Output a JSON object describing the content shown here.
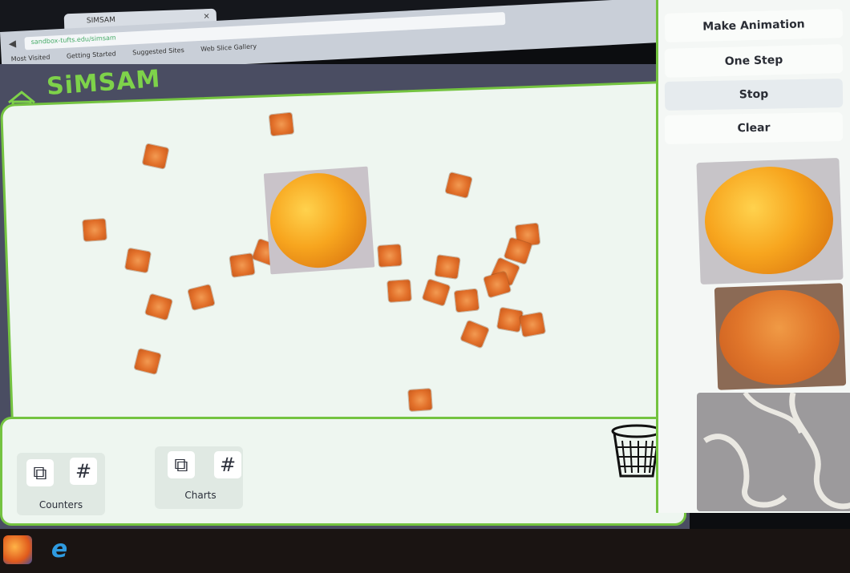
{
  "browser": {
    "tab_title": "SIMSAM",
    "url": "sandbox-tufts.edu/simsam",
    "bookmarks": [
      "Most Visited",
      "Getting Started",
      "Suggested Sites",
      "Web Slice Gallery"
    ]
  },
  "app": {
    "logo": "SiMSAM"
  },
  "sidebar": {
    "buttons": [
      "Make Animation",
      "One Step",
      "Stop",
      "Clear"
    ],
    "active": "Stop"
  },
  "tools": {
    "counters_label": "Counters",
    "charts_label": "Charts",
    "hash_glyph": "#"
  },
  "icons": {
    "home": "home-icon",
    "trash": "trash-icon",
    "duplicate": "copy-icon",
    "hash": "hash-icon"
  },
  "colors": {
    "accent": "#74c340",
    "app_bg": "#4a4d62",
    "canvas_bg": "#eef6f0",
    "orange": "#e2702a"
  }
}
